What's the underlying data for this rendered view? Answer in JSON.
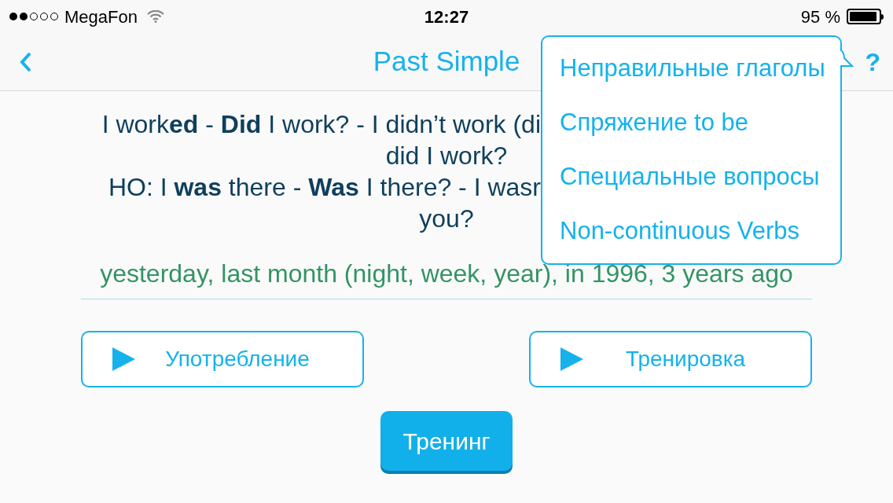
{
  "status_bar": {
    "carrier": "MegaFon",
    "time": "12:27",
    "battery": "95 %"
  },
  "nav": {
    "title": "Past Simple",
    "help": "?"
  },
  "content": {
    "lines": [
      {
        "text": "I work**ed** - **Did** I work? - I didn’t work (di",
        "kind": "cut"
      },
      {
        "text": "did I work?",
        "kind": "full"
      },
      {
        "text": "HO: I **was** there - **Was** I there? - I wasr",
        "kind": "cut"
      },
      {
        "text": "you?",
        "kind": "full"
      }
    ],
    "examples": "yesterday, last month (night, week, year), in 1996, 3 years ago"
  },
  "buttons": [
    {
      "label": "Употребление"
    },
    {
      "label": "Тренировка"
    }
  ],
  "train_button": {
    "label": "Тренинг"
  },
  "menu": {
    "items": [
      {
        "label": "Неправильные глаголы"
      },
      {
        "label": "Спряжение to be"
      },
      {
        "label": "Специальные вопросы"
      },
      {
        "label": "Non-continuous Verbs"
      }
    ]
  }
}
